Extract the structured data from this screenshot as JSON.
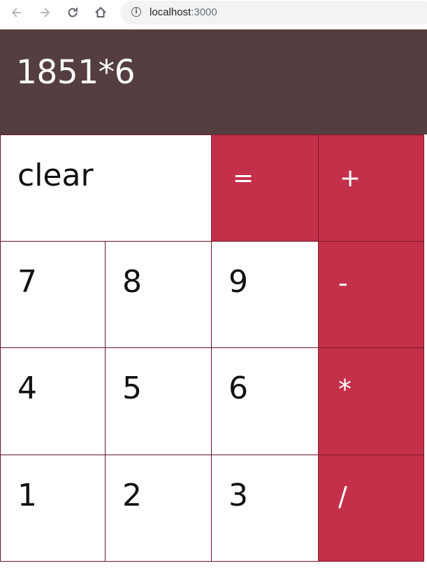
{
  "browser": {
    "back_icon": "arrow-left-icon",
    "forward_icon": "arrow-right-icon",
    "reload_icon": "reload-icon",
    "home_icon": "home-icon",
    "info_icon": "info-icon",
    "url_host": "localhost",
    "url_port": ":3000"
  },
  "calculator": {
    "display": "1851*6",
    "keys": {
      "clear": "clear",
      "equals": "=",
      "plus": "+",
      "minus": "-",
      "multiply": "*",
      "divide": "/",
      "d7": "7",
      "d8": "8",
      "d9": "9",
      "d4": "4",
      "d5": "5",
      "d6": "6",
      "d1": "1",
      "d2": "2",
      "d3": "3"
    },
    "colors": {
      "display_bg": "#553e3f",
      "operator_bg": "#c42f4a",
      "key_border": "#6b1424",
      "digit_bg": "#ffffff"
    }
  }
}
